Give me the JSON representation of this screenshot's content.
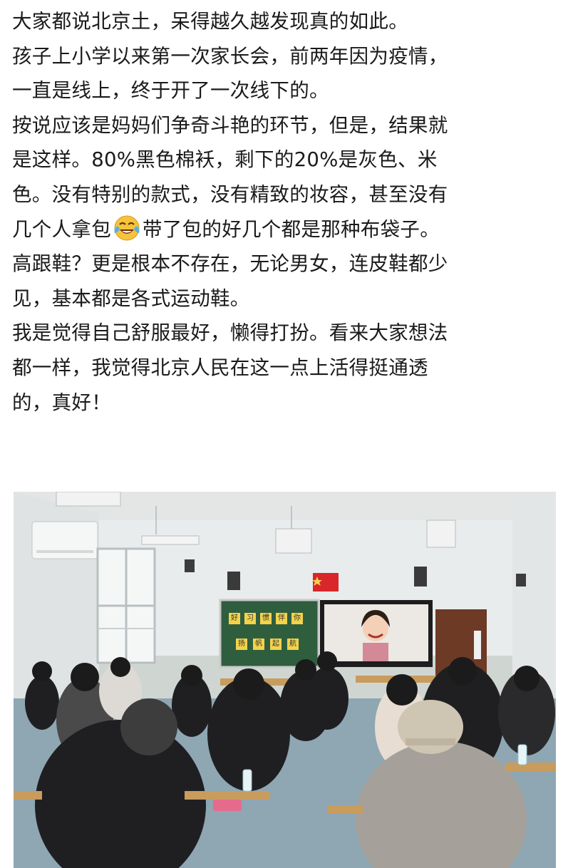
{
  "post": {
    "paragraphs": [
      {
        "lines": [
          "大家都说北京土，呆得越久越发现真的如此。"
        ]
      },
      {
        "lines": [
          "孩子上小学以来第一次家长会，前两年因为疫情，",
          "一直是线上，终于开了一次线下的。"
        ]
      },
      {
        "lines": [
          "按说应该是妈妈们争奇斗艳的环节，但是，结果就",
          "是这样。80%黑色棉袄，剩下的20%是灰色、米",
          "色。没有特别的款式，没有精致的妆容，甚至没有"
        ]
      },
      {
        "before_emoji": "几个人拿包",
        "after_emoji": "带了包的好几个都是那种布袋子。"
      },
      {
        "lines": [
          "高跟鞋？更是根本不存在，无论男女，连皮鞋都少",
          "见，基本都是各式运动鞋。"
        ]
      },
      {
        "lines": [
          "我是觉得自己舒服最好，懒得打扮。看来大家想法",
          "都一样，我觉得北京人民在这一点上活得挺通透",
          "的，真好！"
        ]
      }
    ],
    "emoji_icon": "crying-laughing-emoji-icon"
  },
  "photo": {
    "blackboard_row1": [
      "好",
      "习",
      "惯",
      "伴",
      "你"
    ],
    "blackboard_row2": [
      "扬",
      "帆",
      "起",
      "航"
    ]
  },
  "colors": {
    "text": "#1a1a1a",
    "blackboard": "#2f5e3f",
    "flag": "#d8262a",
    "char_card": "#f3d34a"
  }
}
